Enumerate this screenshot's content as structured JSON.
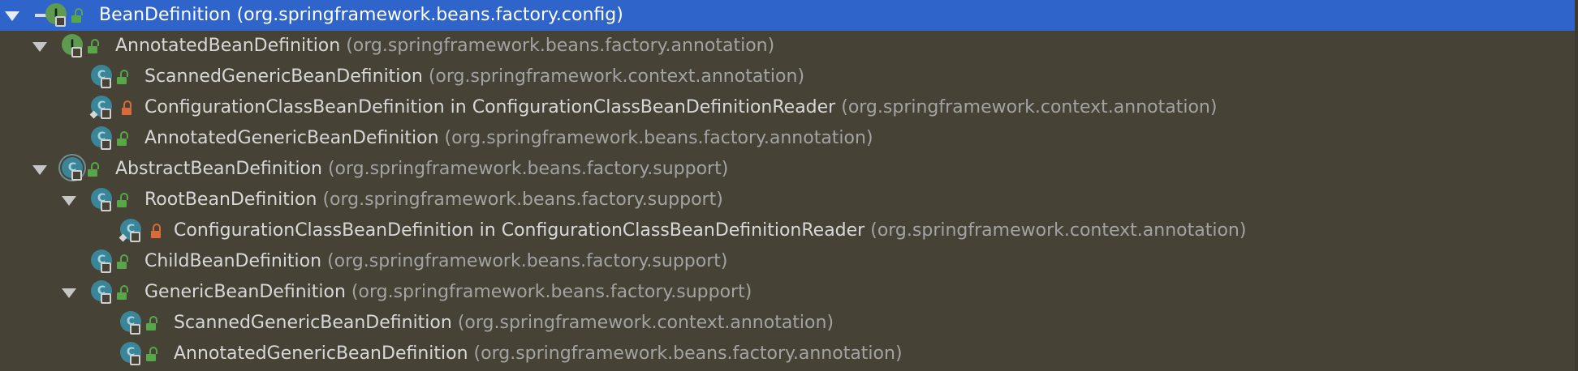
{
  "tree": {
    "rows": [
      {
        "name": "BeanDefinition",
        "package": "(org.springframework.beans.factory.config)",
        "kind": "interface",
        "kind_letter": "I",
        "visibility": "public",
        "expanded": true,
        "selected": true,
        "depth": 0,
        "has_arrow": true,
        "marker": "goto-arrow"
      },
      {
        "name": "AnnotatedBeanDefinition",
        "package": "(org.springframework.beans.factory.annotation)",
        "kind": "interface",
        "kind_letter": "I",
        "visibility": "public",
        "expanded": true,
        "selected": false,
        "depth": 1,
        "has_arrow": true
      },
      {
        "name": "ScannedGenericBeanDefinition",
        "package": "(org.springframework.context.annotation)",
        "kind": "class",
        "kind_letter": "C",
        "visibility": "public",
        "selected": false,
        "depth": 2,
        "has_arrow": false
      },
      {
        "name": "ConfigurationClassBeanDefinition in ConfigurationClassBeanDefinitionReader",
        "package": "(org.springframework.context.annotation)",
        "kind": "class",
        "kind_letter": "C",
        "visibility": "private",
        "static": true,
        "selected": false,
        "depth": 2,
        "has_arrow": false
      },
      {
        "name": "AnnotatedGenericBeanDefinition",
        "package": "(org.springframework.beans.factory.annotation)",
        "kind": "class",
        "kind_letter": "C",
        "visibility": "public",
        "selected": false,
        "depth": 2,
        "has_arrow": false
      },
      {
        "name": "AbstractBeanDefinition",
        "package": "(org.springframework.beans.factory.support)",
        "kind": "abstract",
        "kind_letter": "C",
        "visibility": "public",
        "expanded": true,
        "selected": false,
        "depth": 1,
        "has_arrow": true
      },
      {
        "name": "RootBeanDefinition",
        "package": "(org.springframework.beans.factory.support)",
        "kind": "class",
        "kind_letter": "C",
        "visibility": "public",
        "expanded": true,
        "selected": false,
        "depth": 2,
        "has_arrow": true
      },
      {
        "name": "ConfigurationClassBeanDefinition in ConfigurationClassBeanDefinitionReader",
        "package": "(org.springframework.context.annotation)",
        "kind": "class",
        "kind_letter": "C",
        "visibility": "private",
        "static": true,
        "selected": false,
        "depth": 3,
        "has_arrow": false
      },
      {
        "name": "ChildBeanDefinition",
        "package": "(org.springframework.beans.factory.support)",
        "kind": "class",
        "kind_letter": "C",
        "visibility": "public",
        "selected": false,
        "depth": 2,
        "has_arrow": false
      },
      {
        "name": "GenericBeanDefinition",
        "package": "(org.springframework.beans.factory.support)",
        "kind": "class",
        "kind_letter": "C",
        "visibility": "public",
        "expanded": true,
        "selected": false,
        "depth": 2,
        "has_arrow": true
      },
      {
        "name": "ScannedGenericBeanDefinition",
        "package": "(org.springframework.context.annotation)",
        "kind": "class",
        "kind_letter": "C",
        "visibility": "public",
        "selected": false,
        "depth": 3,
        "has_arrow": false
      },
      {
        "name": "AnnotatedGenericBeanDefinition",
        "package": "(org.springframework.beans.factory.annotation)",
        "kind": "class",
        "kind_letter": "C",
        "visibility": "public",
        "selected": false,
        "depth": 3,
        "has_arrow": false
      }
    ]
  },
  "colors": {
    "background": "#464236",
    "selection": "#2f65ca",
    "name_text": "#d8d8d8",
    "package_text": "#a3a3a3",
    "interface_icon": "#5e9a50",
    "class_icon": "#3b8599",
    "public_lock": "#59a64a",
    "private_lock": "#d96a3a"
  }
}
